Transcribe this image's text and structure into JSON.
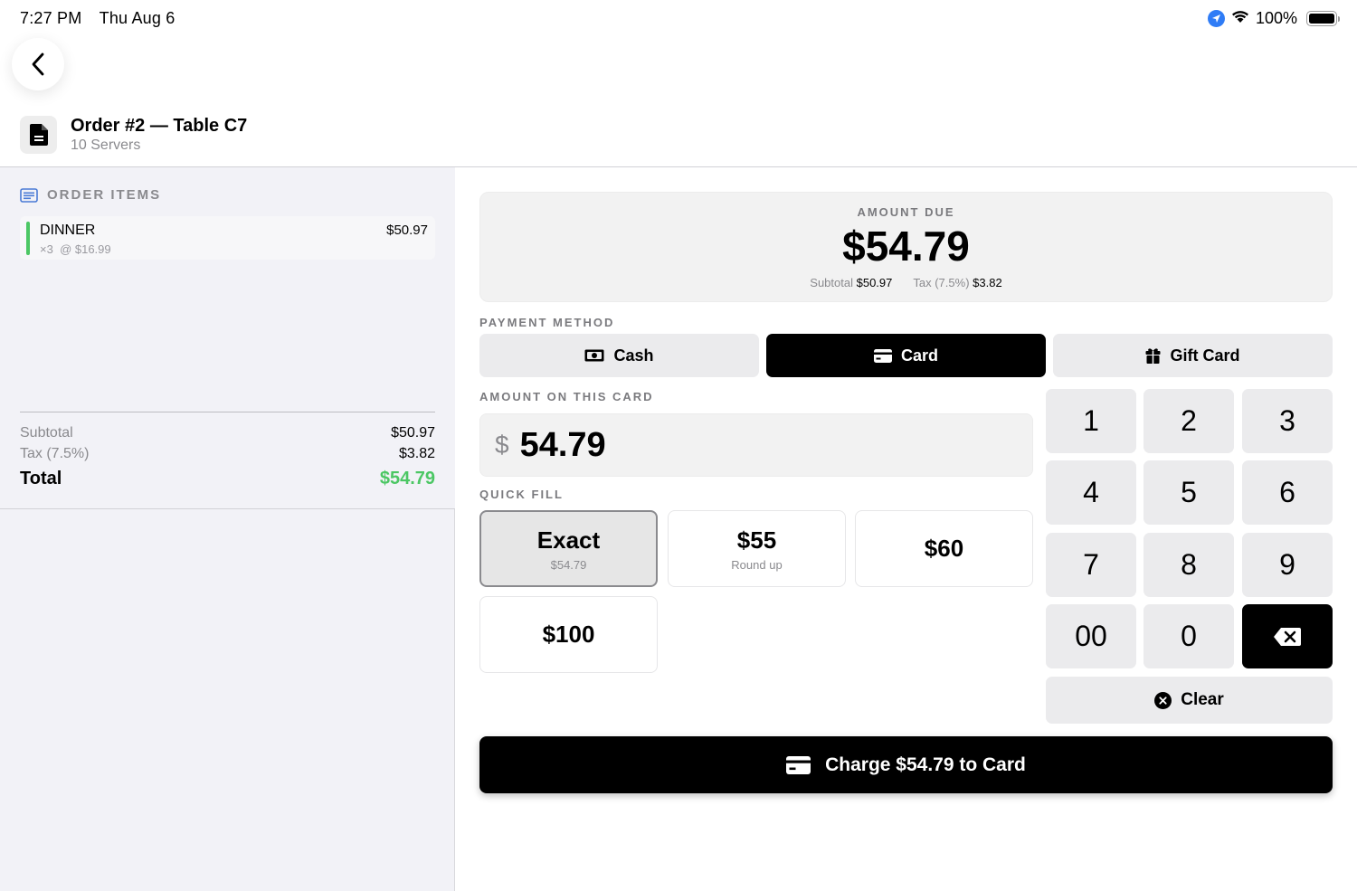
{
  "status_bar": {
    "time": "7:27 PM",
    "date": "Thu Aug 6",
    "battery": "100%",
    "battery_level": 1.0,
    "icons": [
      "location-icon",
      "wifi-icon",
      "battery-icon"
    ]
  },
  "nav": {
    "back_icon": "chevron-left-icon"
  },
  "header": {
    "icon": "document-icon",
    "title": "Order #2 — Table C7",
    "subtitle": "10 Servers"
  },
  "order_items": {
    "heading": "ORDER ITEMS",
    "items": [
      {
        "name": "DINNER",
        "qty": "×3",
        "unit": "@ $16.99",
        "price": "$50.97",
        "accent": "#4cc764"
      }
    ]
  },
  "totals": {
    "subtotal_label": "Subtotal",
    "subtotal": "$50.97",
    "tax_label": "Tax (7.5%)",
    "tax": "$3.82",
    "total_label": "Total",
    "total": "$54.79"
  },
  "amount_due": {
    "label": "AMOUNT DUE",
    "value": "$54.79",
    "subtotal_label": "Subtotal",
    "subtotal": "$50.97",
    "tax_label": "Tax (7.5%)",
    "tax": "$3.82"
  },
  "payment_method": {
    "label": "PAYMENT METHOD",
    "options": [
      {
        "label": "Cash",
        "icon": "cash-icon",
        "active": false
      },
      {
        "label": "Card",
        "icon": "card-icon",
        "active": true
      },
      {
        "label": "Gift Card",
        "icon": "gift-icon",
        "active": false
      }
    ]
  },
  "amount_input": {
    "label": "AMOUNT ON THIS CARD",
    "currency": "$",
    "value": "54.79"
  },
  "quick_fill": {
    "label": "QUICK FILL",
    "options": [
      {
        "label": "Exact",
        "sub": "$54.79",
        "selected": true
      },
      {
        "label": "$55",
        "sub": "Round up",
        "selected": false
      },
      {
        "label": "$60",
        "sub": "",
        "selected": false
      },
      {
        "label": "$100",
        "sub": "",
        "selected": false
      }
    ]
  },
  "keypad": {
    "keys": [
      "1",
      "2",
      "3",
      "4",
      "5",
      "6",
      "7",
      "8",
      "9",
      "00",
      "0"
    ],
    "backspace_icon": "backspace-icon",
    "clear_label": "Clear",
    "clear_icon": "clear-circle-icon"
  },
  "charge": {
    "label": "Charge $54.79 to Card",
    "icon": "card-icon"
  },
  "colors": {
    "accent_green": "#4cc764",
    "primary": "#000000",
    "location_blue": "#2f7cf6"
  }
}
